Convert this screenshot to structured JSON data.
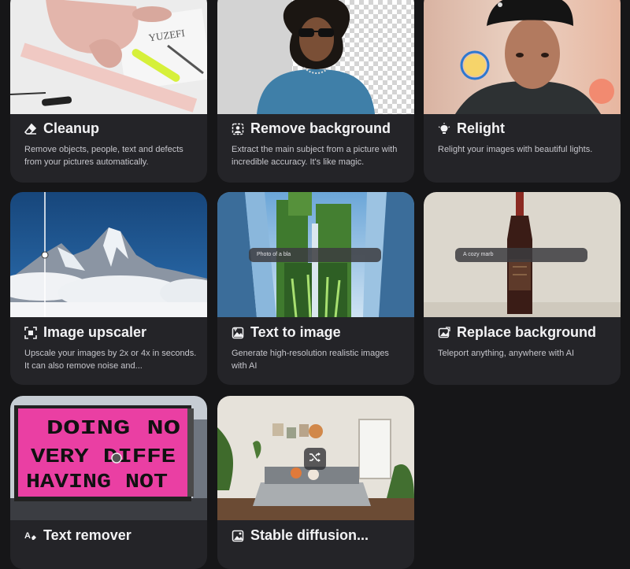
{
  "cards": [
    {
      "title": "Cleanup",
      "description": "Remove objects, people, text and defects from your pictures automatically.",
      "icon": "eraser-icon"
    },
    {
      "title": "Remove background",
      "description": "Extract the main subject from a picture with incredible accuracy. It's like magic.",
      "icon": "cutout-icon"
    },
    {
      "title": "Relight",
      "description": "Relight your images with beautiful lights.",
      "icon": "lightbulb-icon"
    },
    {
      "title": "Image upscaler",
      "description": "Upscale your images by 2x or 4x in seconds. It can also remove noise and...",
      "icon": "upscale-frame-icon"
    },
    {
      "title": "Text to image",
      "description": "Generate high-resolution realistic images with AI",
      "icon": "image-text-icon",
      "prompt": "Photo of a bla"
    },
    {
      "title": "Replace background",
      "description": "Teleport anything, anywhere with AI",
      "icon": "replace-image-icon",
      "prompt": "A cozy marb"
    },
    {
      "title": "Text remover",
      "description": "",
      "icon": "text-erase-icon"
    },
    {
      "title": "Stable diffusion...",
      "description": "",
      "icon": "image-icon"
    }
  ],
  "billboard": {
    "line1": "DOING NO",
    "line2": "VERY DIFFE",
    "line3": "HAVING NOT"
  },
  "packaging_text": "YUZEFI",
  "colors": {
    "background": "#161618",
    "card": "#242428",
    "title": "#f2f2f4",
    "description": "#c6c6cc"
  }
}
